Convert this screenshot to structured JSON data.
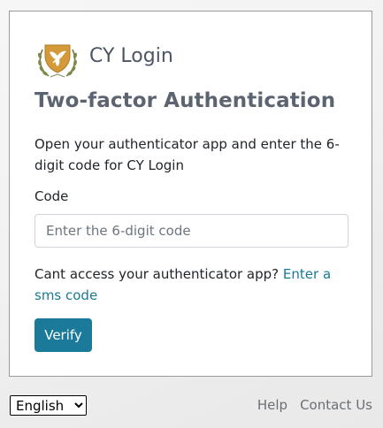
{
  "brand": {
    "name": "CY Login",
    "logo_icon": "cyprus-coat-of-arms-icon"
  },
  "page": {
    "heading": "Two-factor Authentication",
    "instructions": "Open your authenticator app and enter the 6-digit code for CY Login"
  },
  "code_field": {
    "label": "Code",
    "placeholder": "Enter the 6-digit code",
    "value": ""
  },
  "help": {
    "text": "Cant access your authenticator app?",
    "link_label": "Enter a sms code"
  },
  "actions": {
    "verify_label": "Verify",
    "verify_color": "#1b7a99"
  },
  "footer": {
    "language": {
      "selected": "English"
    },
    "help_label": "Help",
    "contact_label": "Contact Us"
  },
  "colors": {
    "link": "#1a7896",
    "heading": "#5b6470"
  }
}
